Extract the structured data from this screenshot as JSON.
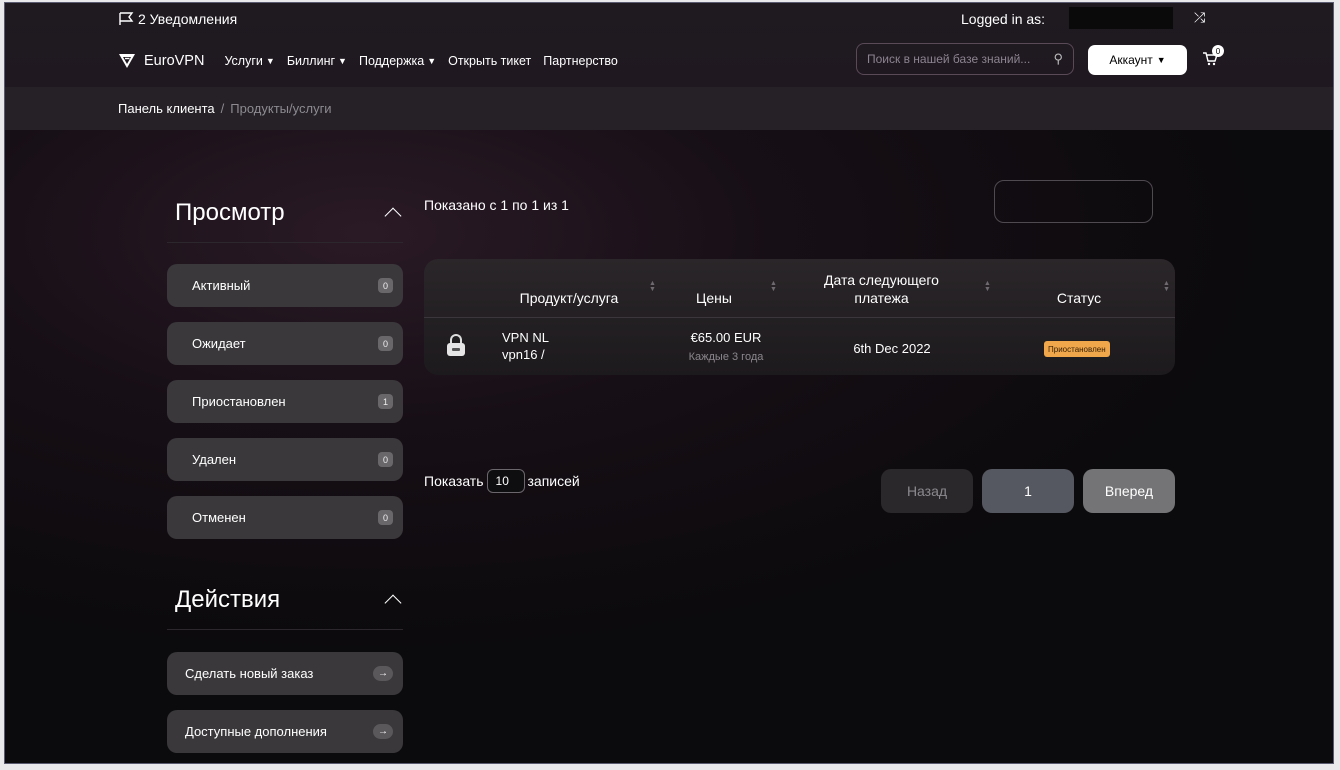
{
  "header": {
    "notifications": "2 Уведомления",
    "logged_in_as": "Logged in as:",
    "brand": "EuroVPN",
    "nav": [
      {
        "label": "Услуги",
        "dropdown": true
      },
      {
        "label": "Биллинг",
        "dropdown": true
      },
      {
        "label": "Поддержка",
        "dropdown": true
      },
      {
        "label": "Открыть тикет",
        "dropdown": false
      },
      {
        "label": "Партнерство",
        "dropdown": false
      }
    ],
    "search_placeholder": "Поиск в нашей базе знаний...",
    "account_label": "Аккаунт",
    "cart_count": "0"
  },
  "breadcrumb": {
    "home": "Панель клиента",
    "separator": "/",
    "current": "Продукты/услуги"
  },
  "sidebar": {
    "view_title": "Просмотр",
    "filters": [
      {
        "label": "Активный",
        "count": "0"
      },
      {
        "label": "Ожидает",
        "count": "0"
      },
      {
        "label": "Приостановлен",
        "count": "1"
      },
      {
        "label": "Удален",
        "count": "0"
      },
      {
        "label": "Отменен",
        "count": "0"
      }
    ],
    "actions_title": "Действия",
    "actions": [
      {
        "label": "Сделать новый заказ",
        "icon": "arrow-right-icon"
      },
      {
        "label": "Доступные дополнения",
        "icon": "arrow-right-icon"
      }
    ]
  },
  "main": {
    "showing": "Показано с 1 по 1 из 1",
    "columns": [
      "Продукт/услуга",
      "Цены",
      "Дата следующего платежа",
      "Статус"
    ],
    "rows": [
      {
        "icon": "lock-icon",
        "product": "VPN NL",
        "service": "vpn16 /",
        "price": "€65.00 EUR",
        "cycle": "Каждые 3 года",
        "next_date": "6th Dec 2022",
        "status": "Приостановлен",
        "status_color": "#f0a64a"
      }
    ],
    "show_prefix": "Показать",
    "show_count": "10",
    "show_suffix": "записей",
    "prev": "Назад",
    "page": "1",
    "next": "Вперед"
  }
}
